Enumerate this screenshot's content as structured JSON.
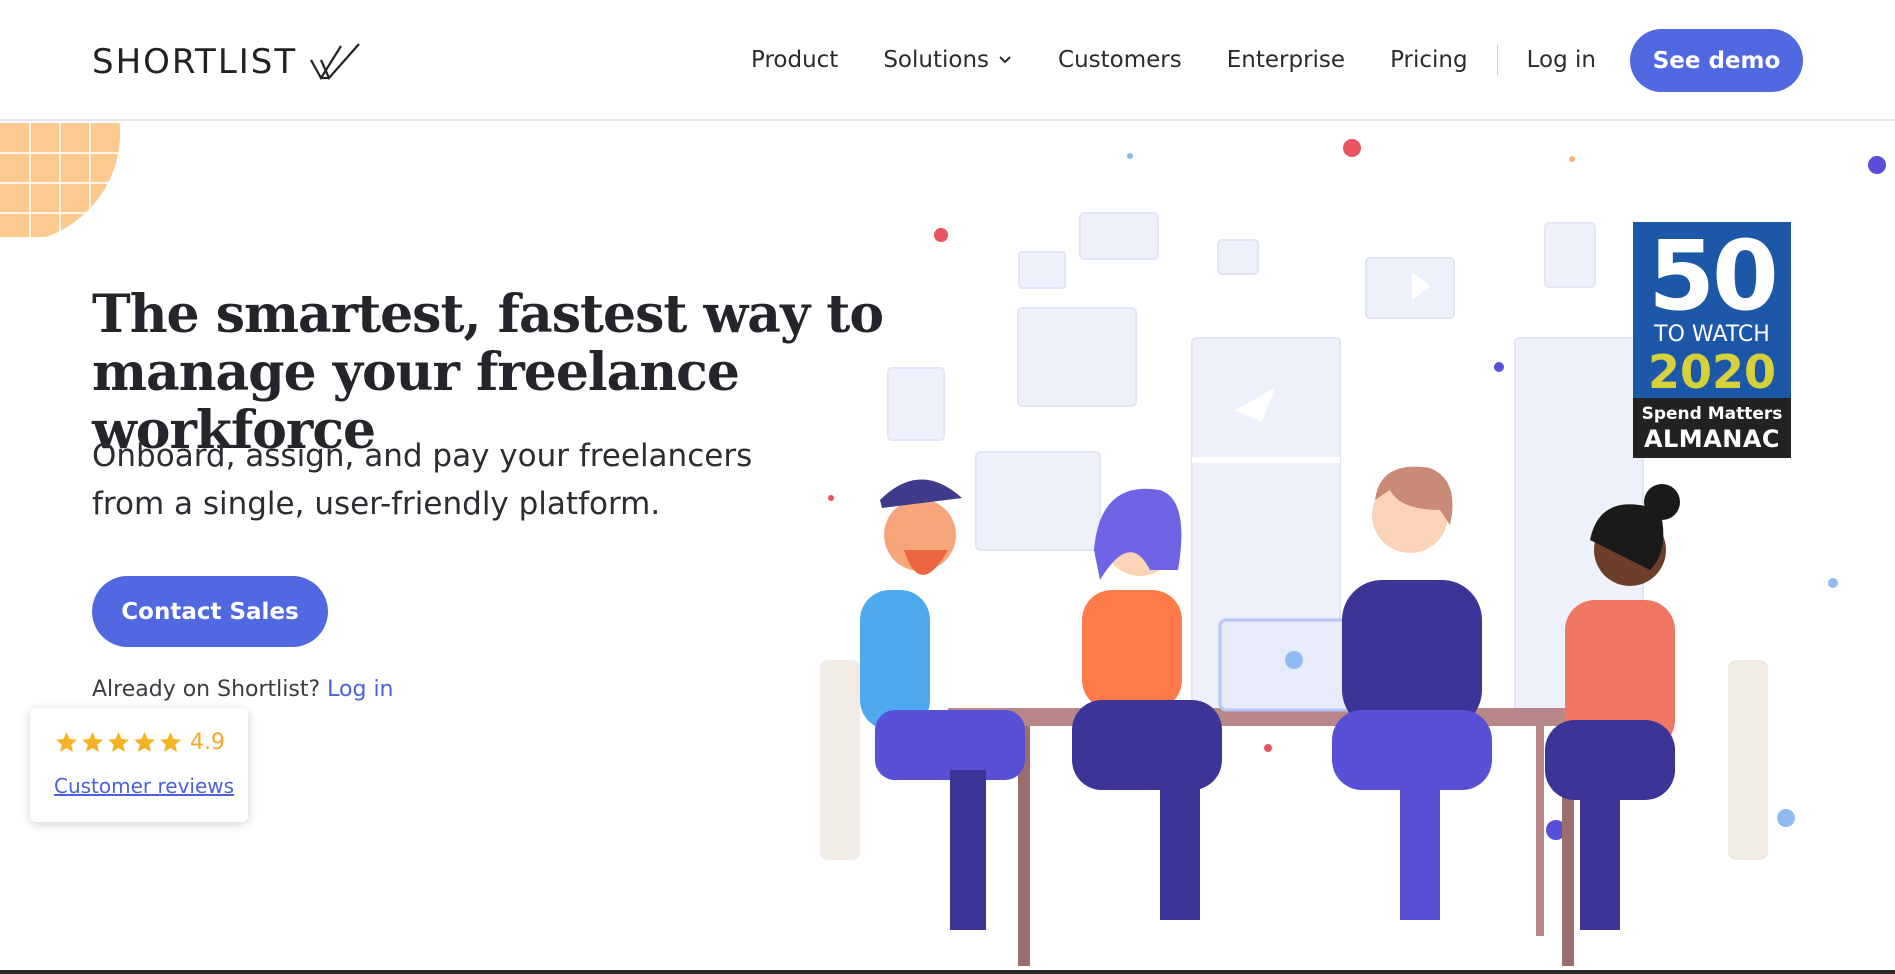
{
  "header": {
    "logo_text": "SHORTLIST",
    "nav": [
      {
        "label": "Product"
      },
      {
        "label": "Solutions",
        "has_dropdown": true
      },
      {
        "label": "Customers"
      },
      {
        "label": "Enterprise"
      },
      {
        "label": "Pricing"
      },
      {
        "label": "Log in"
      }
    ],
    "demo_label": "See demo"
  },
  "hero": {
    "headline": "The smartest, fastest way to manage your freelance workforce",
    "subhead": "Onboard, assign, and pay your freelancers from a single, user-friendly platform.",
    "cta_label": "Contact Sales",
    "already_text": "Already on Shortlist?",
    "already_link": "Log in"
  },
  "reviews": {
    "stars": 5,
    "rating": "4.9",
    "link_label": "Customer reviews"
  },
  "badge": {
    "number": "50",
    "to_watch": "TO WATCH",
    "year": "2020",
    "brand": "Spend Matters",
    "almanac": "ALMANAC"
  },
  "colors": {
    "accent": "#5169e0",
    "link": "#4a62d6",
    "star": "#f5b323",
    "badge_blue": "#1d58a8",
    "badge_year": "#d6d03a"
  },
  "icons": [
    "check-logo-icon",
    "chevron-down-icon",
    "star-icon"
  ]
}
